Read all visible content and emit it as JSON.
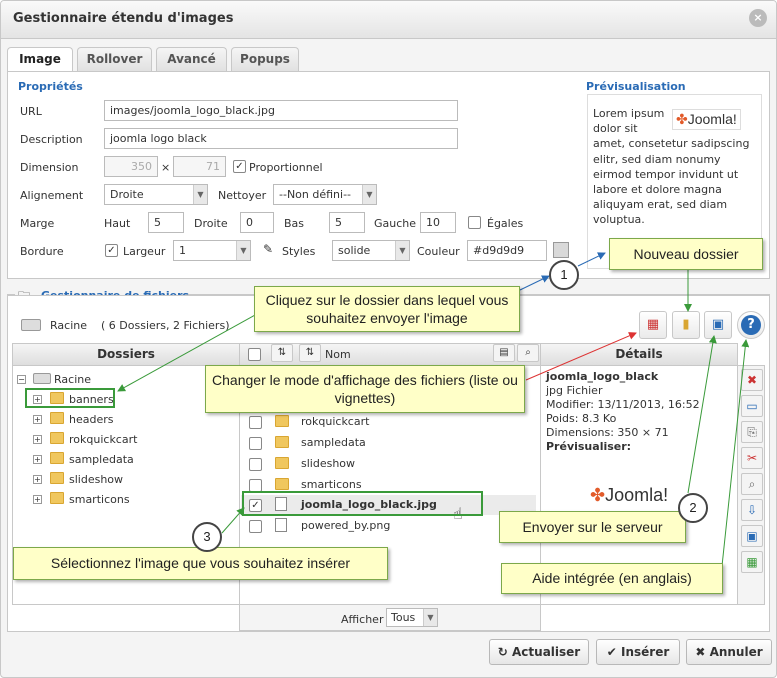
{
  "dialog": {
    "title": "Gestionnaire étendu d'images",
    "close_label": "×"
  },
  "tabs": [
    {
      "label": "Image"
    },
    {
      "label": "Rollover"
    },
    {
      "label": "Avancé"
    },
    {
      "label": "Popups"
    }
  ],
  "props": {
    "section_title": "Propriétés",
    "url_label": "URL",
    "url_value": "images/joomla_logo_black.jpg",
    "desc_label": "Description",
    "desc_value": "joomla logo black",
    "dim_label": "Dimension",
    "width_value": "350",
    "dim_sep": "×",
    "height_value": "71",
    "proportional_label": "Proportionnel",
    "align_label": "Alignement",
    "align_value": "Droite",
    "clear_label": "Nettoyer",
    "clear_value": "--Non défini--",
    "margin_label": "Marge",
    "top_label": "Haut",
    "top_value": "5",
    "right_label": "Droite",
    "right_value": "0",
    "bottom_label": "Bas",
    "bottom_value": "5",
    "left_label": "Gauche",
    "left_value": "10",
    "equal_label": "Égales",
    "border_label": "Bordure",
    "width_label": "Largeur",
    "border_width_value": "1",
    "style_label": "Styles",
    "style_value": "solide",
    "color_label": "Couleur",
    "color_value": "#d9d9d9"
  },
  "preview": {
    "title": "Prévisualisation",
    "text": "Lorem ipsum dolor sit amet, consetetur sadipscing elitr, sed diam nonumy eirmod tempor invidunt ut labore et dolore magna aliquyam erat, sed diam voluptua.",
    "logo_text": "Joomla!"
  },
  "filemanager": {
    "title": "Gestionnaire de fichiers",
    "root_label": "Racine",
    "summary": "( 6 Dossiers, 2 Fichiers)",
    "folders_header": "Dossiers",
    "name_header": "Nom",
    "details_header": "Détails",
    "tree_root": "Racine",
    "tree": [
      {
        "label": "banners"
      },
      {
        "label": "headers"
      },
      {
        "label": "rokquickcart"
      },
      {
        "label": "sampledata"
      },
      {
        "label": "slideshow"
      },
      {
        "label": "smarticons"
      }
    ],
    "files": [
      {
        "name": "rokquickcart"
      },
      {
        "name": "sampledata"
      },
      {
        "name": "slideshow"
      },
      {
        "name": "smarticons"
      },
      {
        "name": "joomla_logo_black.jpg"
      },
      {
        "name": "powered_by.png"
      }
    ],
    "details": {
      "name": "joomla_logo_black",
      "type": "jpg Fichier",
      "modified": "Modifier: 13/11/2013, 16:52",
      "size": "Poids: 8.3 Ko",
      "dimensions": "Dimensions: 350 × 71",
      "preview_label": "Prévisualiser:",
      "logo_text": "Joomla!"
    },
    "show_label": "Afficher",
    "show_value": "Tous"
  },
  "buttons": {
    "refresh": "Actualiser",
    "insert": "Insérer",
    "cancel": "Annuler"
  },
  "callouts": {
    "new_folder": "Nouveau dossier",
    "click_folder": "Cliquez sur le dossier dans lequel vous souhaitez envoyer l'image",
    "change_mode": "Changer le mode d'affichage des fichiers (liste ou vignettes)",
    "upload": "Envoyer sur le serveur",
    "help": "Aide intégrée (en anglais)",
    "select_image": "Sélectionnez l'image que vous souhaitez insérer",
    "num1": "1",
    "num2": "2",
    "num3": "3"
  },
  "colors": {
    "accent": "#2a6bb5",
    "callout_bg": "#ffffc8",
    "callout_border": "#7ca84a",
    "highlight": "#3a9a3a"
  }
}
